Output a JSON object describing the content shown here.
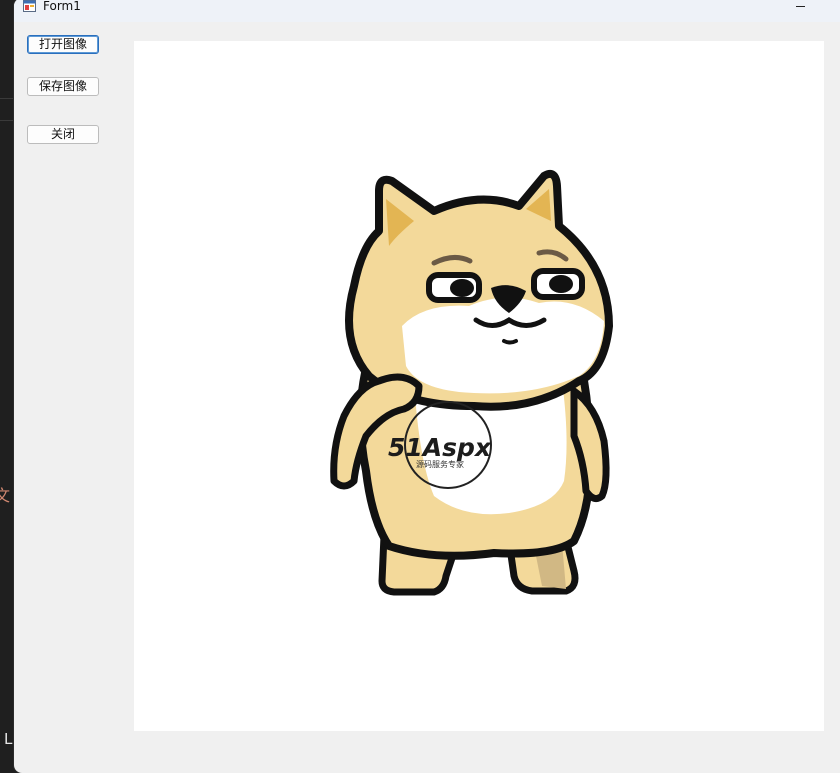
{
  "window": {
    "title": "Form1"
  },
  "buttons": {
    "open_label": "打开图像",
    "save_label": "保存图像",
    "close_label": "关闭"
  },
  "picture": {
    "watermark_brand": "51Aspx",
    "watermark_tagline": "源码服务专家"
  },
  "background": {
    "left_fragment_char": "文",
    "bottom_fragment_char": "L"
  }
}
